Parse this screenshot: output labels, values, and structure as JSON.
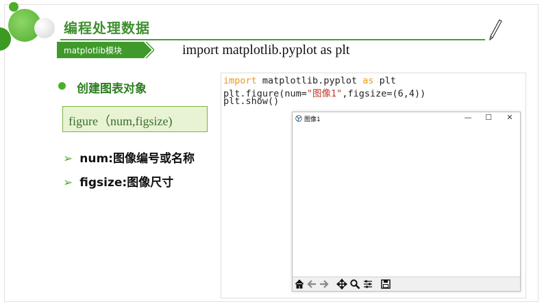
{
  "slide": {
    "title": "编程处理数据",
    "module_tag": "matplotlib模块",
    "import_heading": "import matplotlib.pyplot as plt",
    "section_heading": "创建图表对象",
    "function_signature": "figure（num,figsize)",
    "params": [
      {
        "text": "num:图像编号或名称"
      },
      {
        "text": "figsize:图像尺寸"
      }
    ]
  },
  "code": {
    "line1": {
      "kw_import": "import",
      "mid": " matplotlib.pyplot ",
      "kw_as": "as",
      "end": " plt"
    },
    "line2": {
      "start": "plt.figure(num=",
      "str": "\"图像1\"",
      "end": ",figsize=(6,4))"
    },
    "line3": "plt.show()"
  },
  "figure_window": {
    "title": "图像1",
    "controls": {
      "minimize": "—",
      "maximize": "☐",
      "close": "✕"
    },
    "toolbar_icons": [
      "home-icon",
      "back-arrow-icon",
      "forward-arrow-icon",
      "pan-icon",
      "zoom-icon",
      "configure-subplots-icon",
      "save-icon"
    ]
  },
  "colors": {
    "accent_green": "#4caf2a",
    "title_green": "#3f8f2f",
    "keyword_orange": "#e69a1a",
    "string_red": "#c0392b"
  }
}
